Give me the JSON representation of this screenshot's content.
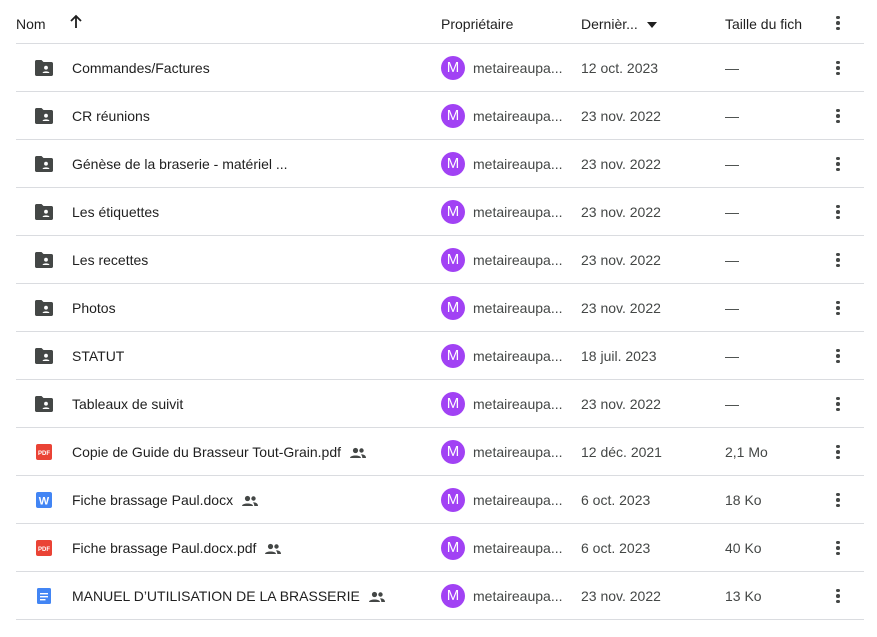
{
  "header": {
    "name": "Nom",
    "owner": "Propriétaire",
    "date": "Dernièr...",
    "size": "Taille du fich"
  },
  "rows": [
    {
      "name": "Commandes/Factures",
      "type": "folder",
      "shared": false,
      "avatar": "M",
      "owner": "metaireaupa...",
      "date": "12 oct. 2023",
      "size": "—"
    },
    {
      "name": "CR réunions",
      "type": "folder",
      "shared": false,
      "avatar": "M",
      "owner": "metaireaupa...",
      "date": "23 nov. 2022",
      "size": "—"
    },
    {
      "name": "Génèse de la braserie - matériel ...",
      "type": "folder",
      "shared": false,
      "avatar": "M",
      "owner": "metaireaupa...",
      "date": "23 nov. 2022",
      "size": "—"
    },
    {
      "name": "Les étiquettes",
      "type": "folder",
      "shared": false,
      "avatar": "M",
      "owner": "metaireaupa...",
      "date": "23 nov. 2022",
      "size": "—"
    },
    {
      "name": "Les recettes",
      "type": "folder",
      "shared": false,
      "avatar": "M",
      "owner": "metaireaupa...",
      "date": "23 nov. 2022",
      "size": "—"
    },
    {
      "name": "Photos",
      "type": "folder",
      "shared": false,
      "avatar": "M",
      "owner": "metaireaupa...",
      "date": "23 nov. 2022",
      "size": "—"
    },
    {
      "name": "STATUT",
      "type": "folder",
      "shared": false,
      "avatar": "M",
      "owner": "metaireaupa...",
      "date": "18 juil. 2023",
      "size": "—"
    },
    {
      "name": "Tableaux de suivit",
      "type": "folder",
      "shared": false,
      "avatar": "M",
      "owner": "metaireaupa...",
      "date": "23 nov. 2022",
      "size": "—"
    },
    {
      "name": "Copie de Guide du Brasseur Tout-Grain.pdf",
      "type": "pdf",
      "shared": true,
      "avatar": "M",
      "owner": "metaireaupa...",
      "date": "12 déc. 2021",
      "size": "2,1 Mo"
    },
    {
      "name": "Fiche brassage Paul.docx",
      "type": "word",
      "shared": true,
      "avatar": "M",
      "owner": "metaireaupa...",
      "date": "6 oct. 2023",
      "size": "18 Ko"
    },
    {
      "name": "Fiche brassage Paul.docx.pdf",
      "type": "pdf",
      "shared": true,
      "avatar": "M",
      "owner": "metaireaupa...",
      "date": "6 oct. 2023",
      "size": "40 Ko"
    },
    {
      "name": "MANUEL D’UTILISATION DE LA BRASSERIE",
      "type": "gdoc",
      "shared": true,
      "avatar": "M",
      "owner": "metaireaupa...",
      "date": "23 nov. 2022",
      "size": "13 Ko"
    }
  ],
  "icons": {
    "folder": "shared-folder-icon",
    "pdf": "pdf-file-icon",
    "word": "word-file-icon",
    "gdoc": "google-doc-icon",
    "shared": "shared-people-icon",
    "more": "more-vert-icon",
    "sort": "arrow-up-icon"
  },
  "labels": {
    "pdf_badge": "PDF",
    "word_badge": "W"
  },
  "colors": {
    "avatar": "#a142f4",
    "pdf": "#ea4335",
    "word": "#4285f4",
    "gdoc": "#4285f4",
    "folder": "#444746",
    "divider": "#dadce0"
  }
}
